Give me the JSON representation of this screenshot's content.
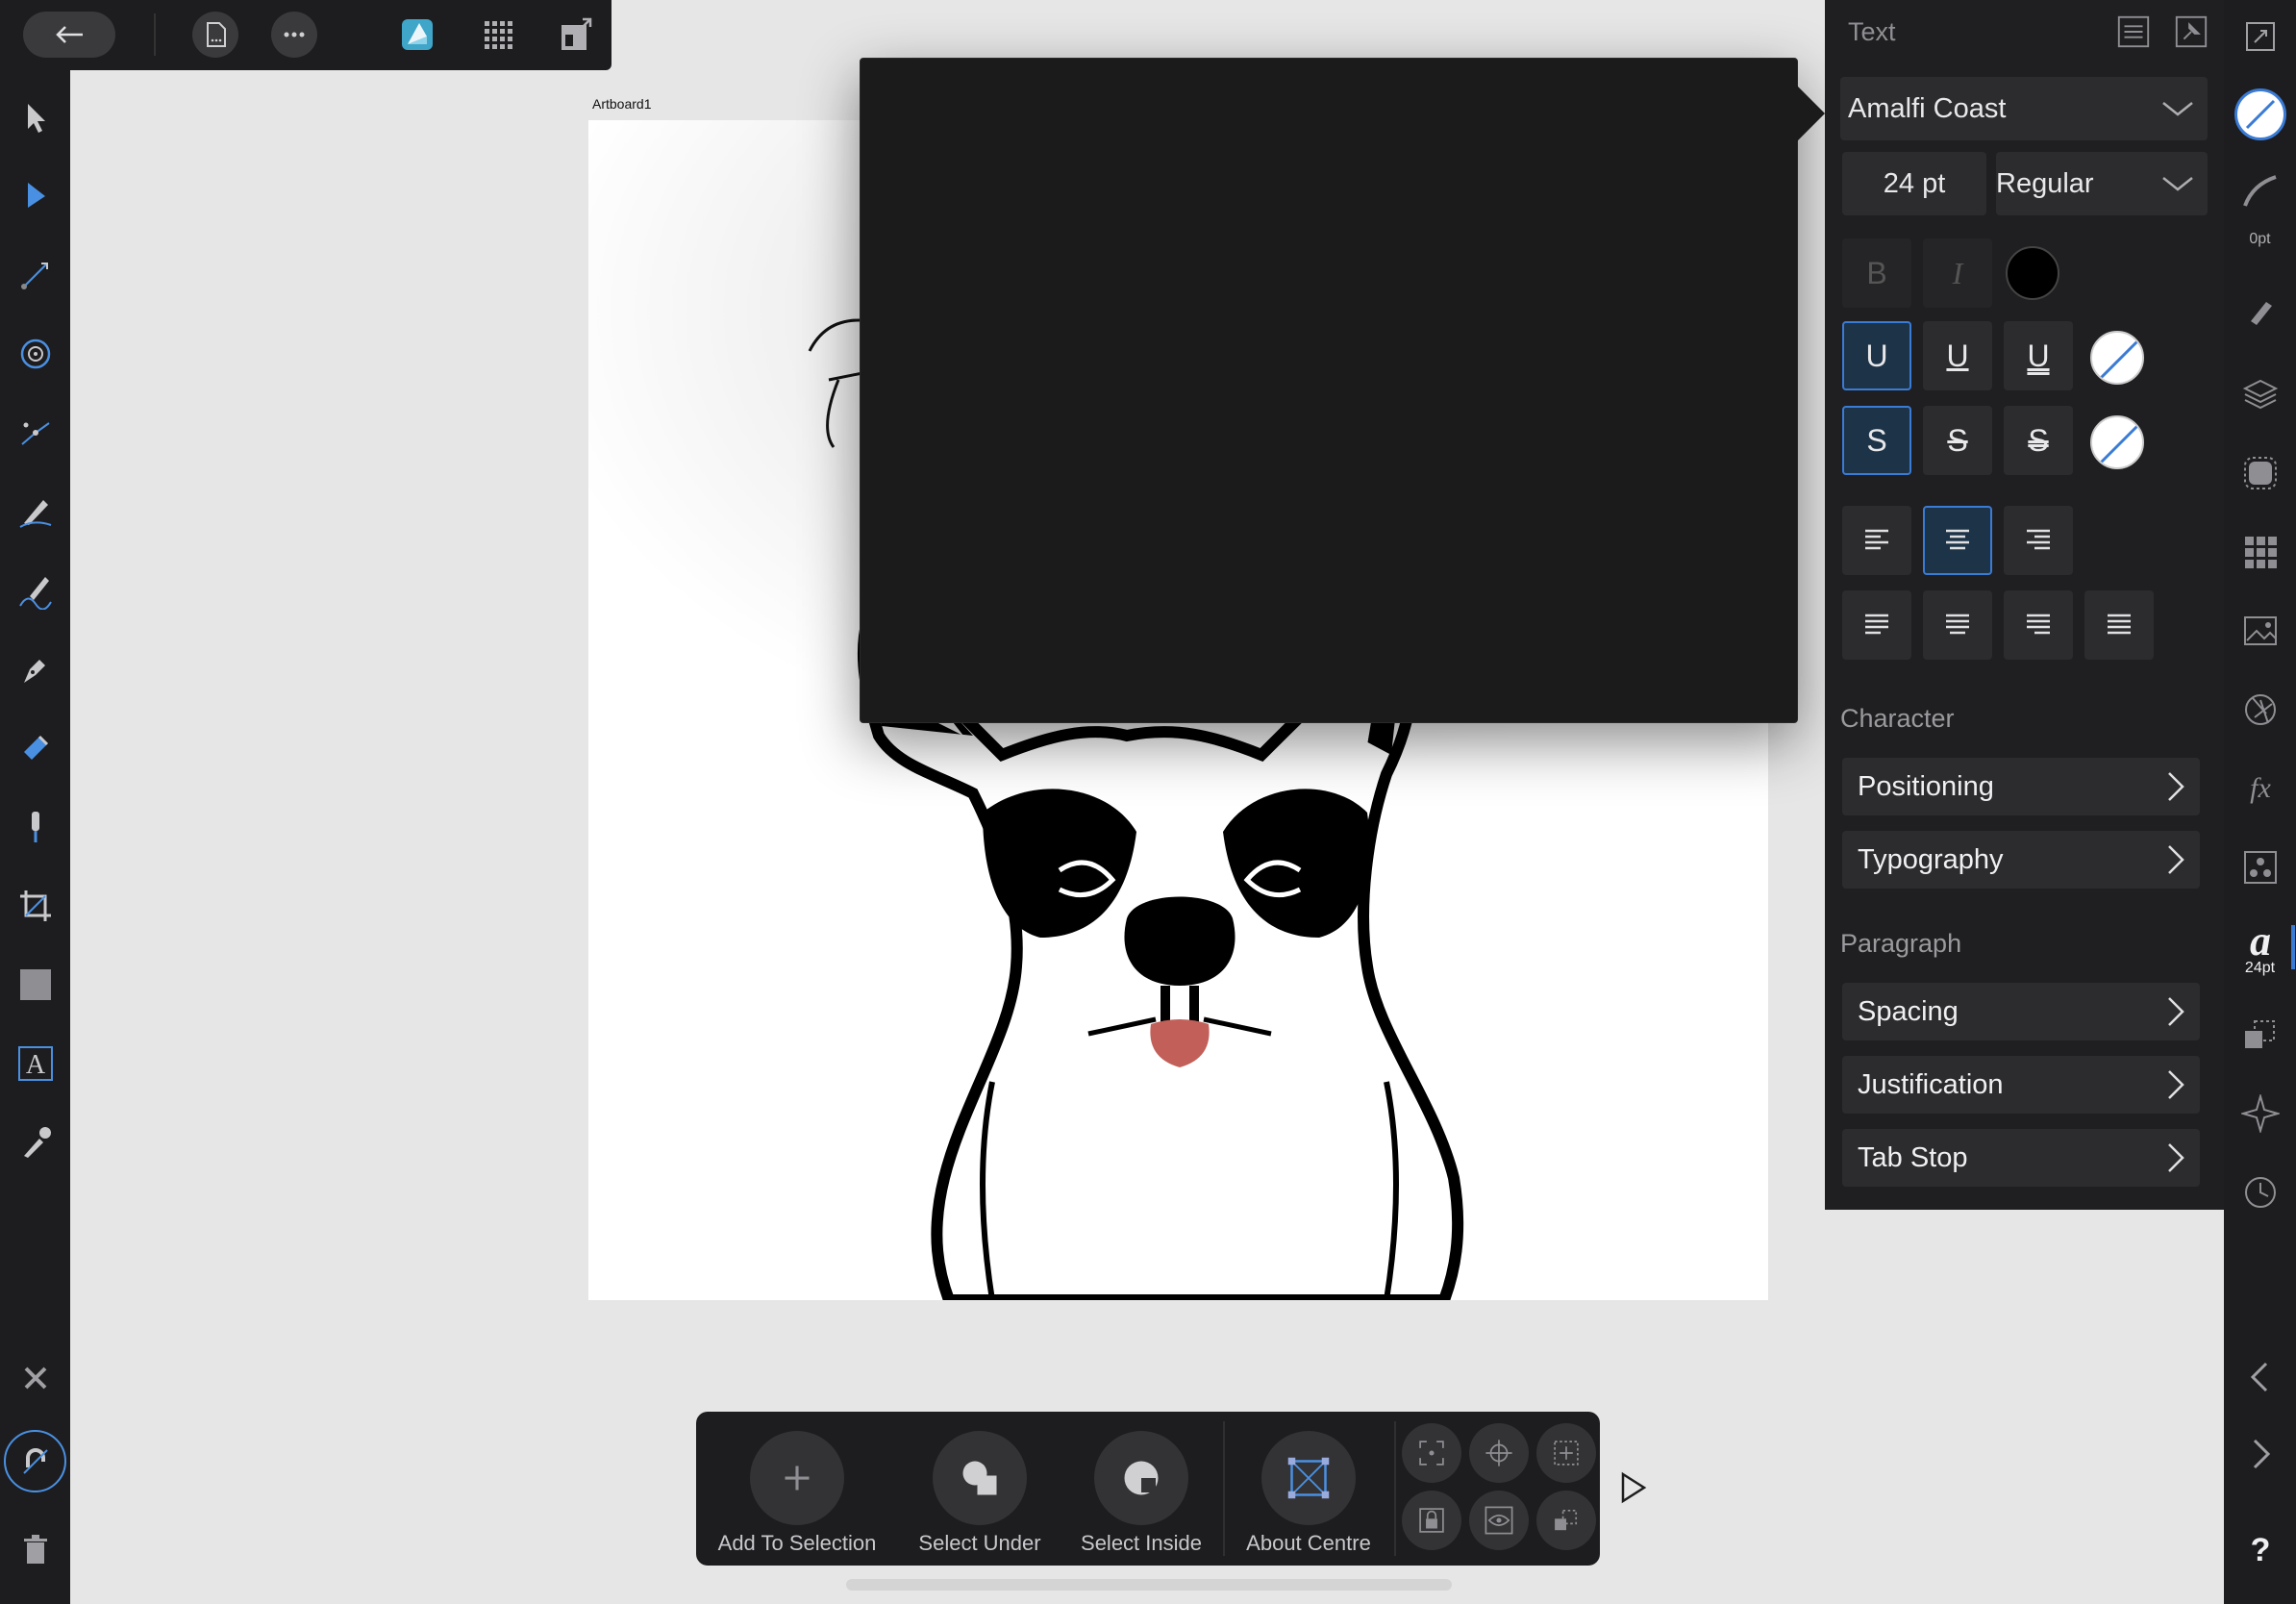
{
  "canvas": {
    "artboard_label": "Artboard1"
  },
  "text_panel": {
    "title": "Text",
    "font_family": "Amalfi Coast",
    "font_size": "24 pt",
    "font_style": "Regular",
    "bold_label": "B",
    "italic_label": "I",
    "underline_labels": [
      "U",
      "U",
      "U"
    ],
    "strike_labels": [
      "S",
      "S",
      "S"
    ],
    "character_section": "Character",
    "character_items": [
      "Positioning",
      "Typography"
    ],
    "paragraph_section": "Paragraph",
    "paragraph_items": [
      "Spacing",
      "Justification",
      "Tab Stop"
    ],
    "text_color": "#000000",
    "accent_color": "#3a7bd5"
  },
  "studio_bar": {
    "stroke_width": "0pt",
    "font_size_caption": "24pt",
    "text_glyph": "a",
    "fx_glyph": "fx",
    "help_glyph": "?"
  },
  "context_toolbar": {
    "add_to_selection": "Add To Selection",
    "select_under": "Select Under",
    "select_inside": "Select Inside",
    "about_centre": "About Centre"
  }
}
